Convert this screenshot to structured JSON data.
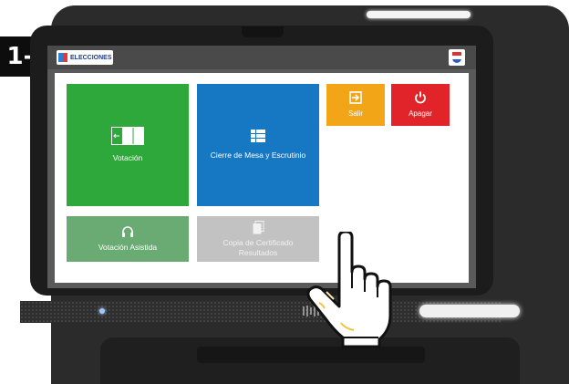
{
  "step": {
    "label": "1-"
  },
  "header": {
    "logo_text": "ELECCIONES"
  },
  "tiles": {
    "voting": {
      "label": "Votación",
      "icon": "ballot-box-icon"
    },
    "closing": {
      "label": "Cierre de Mesa y Escrutinio",
      "icon": "grid-list-icon"
    },
    "assisted": {
      "label": "Votación Asistida",
      "icon": "headphones-icon"
    },
    "copy": {
      "label_line1": "Copia de Certificado",
      "label_line2": "Resultados",
      "icon": "document-copy-icon"
    },
    "exit": {
      "label": "Salir",
      "icon": "exit-icon"
    },
    "shutdown": {
      "label": "Apagar",
      "icon": "power-icon"
    }
  },
  "colors": {
    "voting": "#2ea83a",
    "closing": "#1677c2",
    "assisted": "#6aaa73",
    "copy": "#c2c2c2",
    "exit": "#f2a516",
    "shutdown": "#e0242a"
  }
}
